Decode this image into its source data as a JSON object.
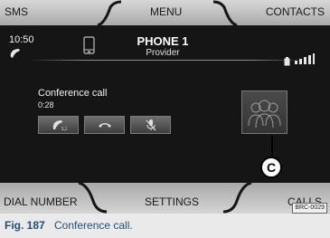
{
  "top_tabs": {
    "sms": "SMS",
    "menu": "MENU",
    "contacts": "CONTACTS"
  },
  "status": {
    "time": "10:50"
  },
  "phone": {
    "name": "PHONE 1",
    "provider": "Provider"
  },
  "call": {
    "title": "Conference call",
    "duration": "0:28",
    "buttons": [
      "conference-icon",
      "hang-up-icon",
      "mute-icon"
    ]
  },
  "bottom_tabs": {
    "dial_number": "DIAL NUMBER",
    "settings": "SETTINGS",
    "calls": "CALLS"
  },
  "callout": {
    "label": "C"
  },
  "ref_code": "BRC-0029",
  "caption": {
    "fig": "Fig. 187",
    "text": "Conference call."
  },
  "colors": {
    "screen_bg": "#151515",
    "bar": "#bdbdbd",
    "caption_text": "#1f4e79"
  }
}
